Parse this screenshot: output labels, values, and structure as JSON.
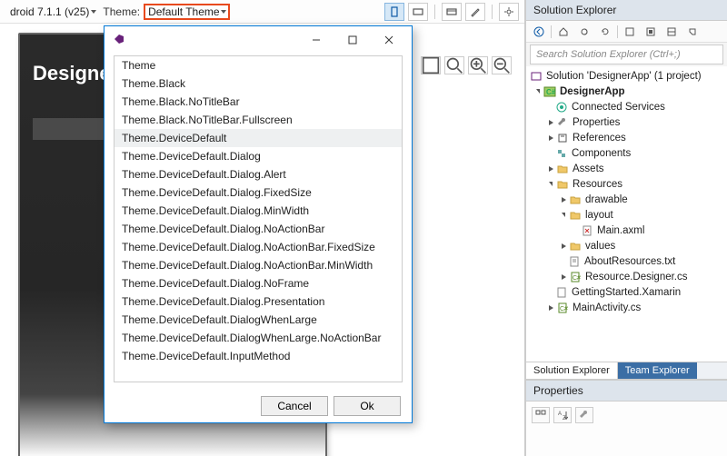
{
  "toolbar": {
    "device": "droid 7.1.1 (v25)",
    "theme_label": "Theme:",
    "theme_value": "Default Theme"
  },
  "phone": {
    "title": "Designe"
  },
  "dialog": {
    "cancel": "Cancel",
    "ok": "Ok",
    "items": [
      "Theme",
      "Theme.Black",
      "Theme.Black.NoTitleBar",
      "Theme.Black.NoTitleBar.Fullscreen",
      "Theme.DeviceDefault",
      "Theme.DeviceDefault.Dialog",
      "Theme.DeviceDefault.Dialog.Alert",
      "Theme.DeviceDefault.Dialog.FixedSize",
      "Theme.DeviceDefault.Dialog.MinWidth",
      "Theme.DeviceDefault.Dialog.NoActionBar",
      "Theme.DeviceDefault.Dialog.NoActionBar.FixedSize",
      "Theme.DeviceDefault.Dialog.NoActionBar.MinWidth",
      "Theme.DeviceDefault.Dialog.NoFrame",
      "Theme.DeviceDefault.Dialog.Presentation",
      "Theme.DeviceDefault.DialogWhenLarge",
      "Theme.DeviceDefault.DialogWhenLarge.NoActionBar",
      "Theme.DeviceDefault.InputMethod"
    ],
    "selected_index": 4
  },
  "solution_explorer": {
    "title": "Solution Explorer",
    "search_placeholder": "Search Solution Explorer (Ctrl+;)",
    "solution": "Solution 'DesignerApp' (1 project)",
    "project": "DesignerApp",
    "nodes": {
      "connected": "Connected Services",
      "properties": "Properties",
      "references": "References",
      "components": "Components",
      "assets": "Assets",
      "resources": "Resources",
      "drawable": "drawable",
      "layout": "layout",
      "main_axml": "Main.axml",
      "values": "values",
      "about_res": "AboutResources.txt",
      "res_designer": "Resource.Designer.cs",
      "getting_started": "GettingStarted.Xamarin",
      "main_activity": "MainActivity.cs"
    },
    "tabs": {
      "sol": "Solution Explorer",
      "team": "Team Explorer"
    }
  },
  "properties": {
    "title": "Properties"
  }
}
